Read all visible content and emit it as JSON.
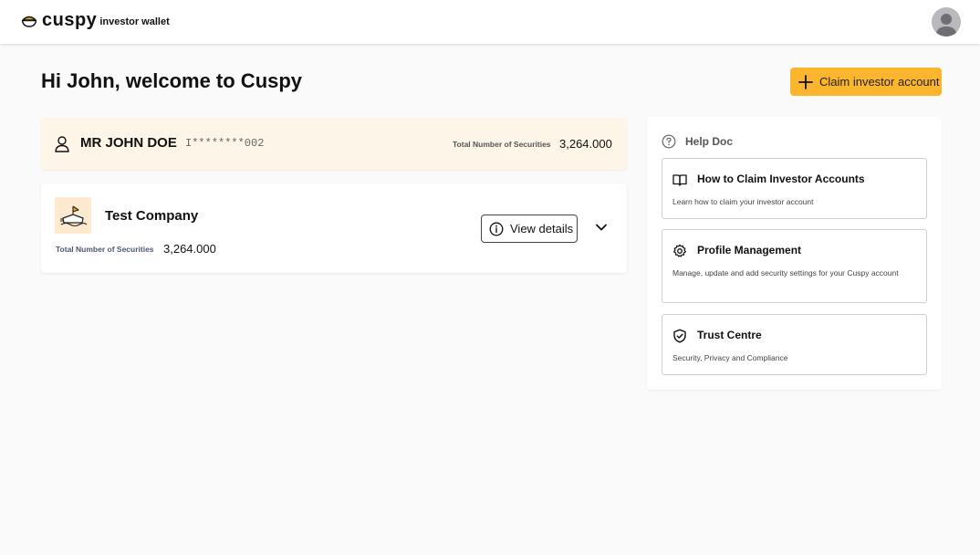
{
  "header": {
    "brand": "cuspy",
    "brand_sub": "investor wallet",
    "avatar_icon": "user-avatar-icon"
  },
  "main": {
    "greeting": "Hi John, welcome to Cuspy",
    "claim_button": "Claim investor account"
  },
  "investor": {
    "name": "MR JOHN DOE",
    "id_masked": "I********002",
    "total_label": "Total Number of Securities",
    "total_value": "3,264.000"
  },
  "company": {
    "name": "Test Company",
    "total_label": "Total Number of Securities",
    "total_value": "3,264.000",
    "view_details": "View details"
  },
  "help": {
    "title": "Help Doc",
    "items": [
      {
        "title": "How to Claim Investor Accounts",
        "desc": "Learn how to claim your investor account",
        "icon": "book-icon"
      },
      {
        "title": "Profile Management",
        "desc": "Manage, update and add security settings for your Cuspy account",
        "icon": "gear-icon"
      },
      {
        "title": "Trust Centre",
        "desc": "Security, Privacy and Compliance",
        "icon": "shield-check-icon"
      }
    ]
  },
  "colors": {
    "accent": "#fbb52e",
    "investor_card_bg": "#fef5e9",
    "page_bg": "#fafafa"
  }
}
